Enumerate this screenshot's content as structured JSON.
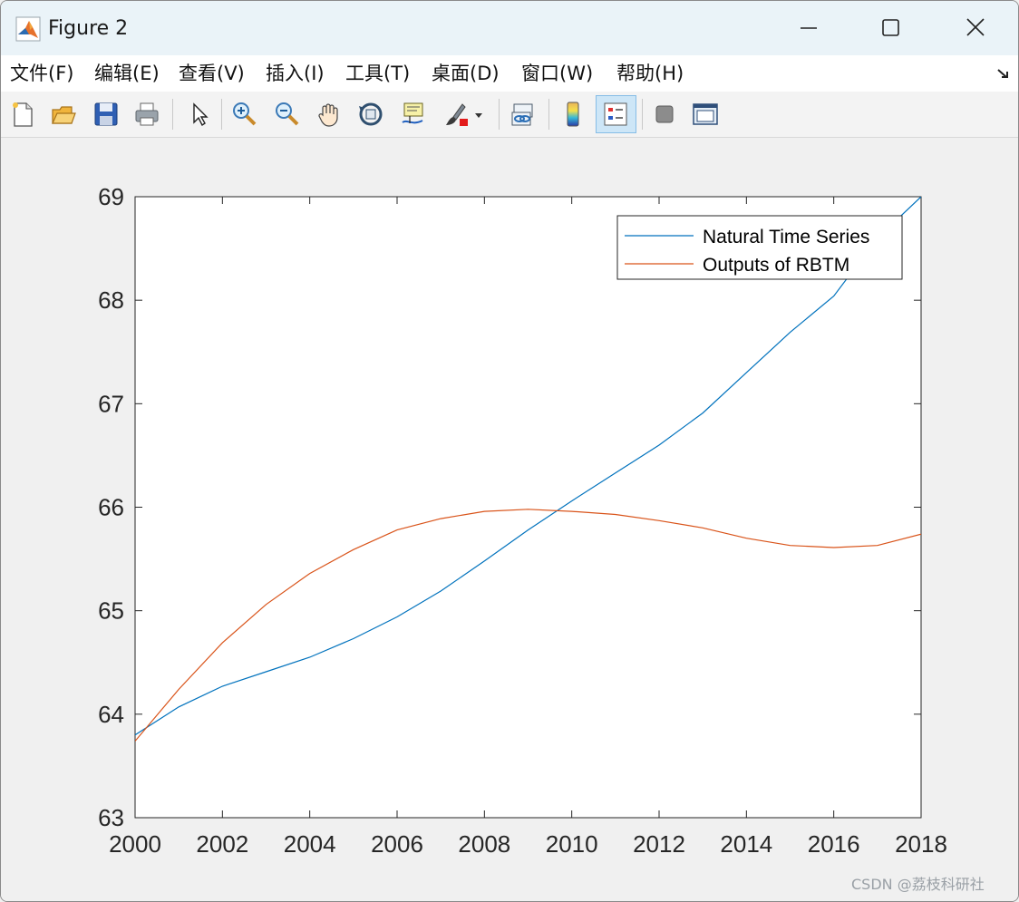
{
  "window": {
    "title": "Figure 2"
  },
  "menu": {
    "items": [
      "文件(F)",
      "编辑(E)",
      "查看(V)",
      "插入(I)",
      "工具(T)",
      "桌面(D)",
      "窗口(W)",
      "帮助(H)"
    ]
  },
  "toolbar": {
    "buttons": [
      {
        "name": "new-figure-icon"
      },
      {
        "name": "open-file-icon"
      },
      {
        "name": "save-icon"
      },
      {
        "name": "print-icon"
      },
      {
        "name": "pointer-icon"
      },
      {
        "name": "zoom-in-icon"
      },
      {
        "name": "zoom-out-icon"
      },
      {
        "name": "pan-hand-icon"
      },
      {
        "name": "rotate-3d-icon"
      },
      {
        "name": "data-cursor-icon"
      },
      {
        "name": "brush-icon"
      },
      {
        "name": "link-plot-icon"
      },
      {
        "name": "colorbar-icon"
      },
      {
        "name": "legend-icon",
        "active": true
      },
      {
        "name": "hide-plot-tools-icon"
      },
      {
        "name": "show-plot-tools-icon"
      }
    ]
  },
  "chart_data": {
    "type": "line",
    "title": "",
    "xlabel": "",
    "ylabel": "",
    "xlim": [
      2000,
      2018
    ],
    "ylim": [
      63,
      69
    ],
    "xticks": [
      2000,
      2002,
      2004,
      2006,
      2008,
      2010,
      2012,
      2014,
      2016,
      2018
    ],
    "yticks": [
      63,
      64,
      65,
      66,
      67,
      68,
      69
    ],
    "grid": false,
    "legend_position": "top-right",
    "x": [
      2000,
      2001,
      2002,
      2003,
      2004,
      2005,
      2006,
      2007,
      2008,
      2009,
      2010,
      2011,
      2012,
      2013,
      2014,
      2015,
      2016,
      2017,
      2018
    ],
    "series": [
      {
        "name": "Natural Time Series",
        "color": "#0072bd",
        "values": [
          63.8,
          64.07,
          64.27,
          64.41,
          64.55,
          64.73,
          64.94,
          65.19,
          65.48,
          65.78,
          66.06,
          66.33,
          66.6,
          66.91,
          67.3,
          67.69,
          68.04,
          68.6,
          69.0
        ]
      },
      {
        "name": "Outputs of RBTM",
        "color": "#d95319",
        "values": [
          63.74,
          64.24,
          64.69,
          65.06,
          65.36,
          65.59,
          65.78,
          65.89,
          65.96,
          65.98,
          65.96,
          65.93,
          65.87,
          65.8,
          65.7,
          65.63,
          65.61,
          65.63,
          65.74
        ]
      }
    ]
  },
  "watermark": "CSDN @荔枝科研社"
}
